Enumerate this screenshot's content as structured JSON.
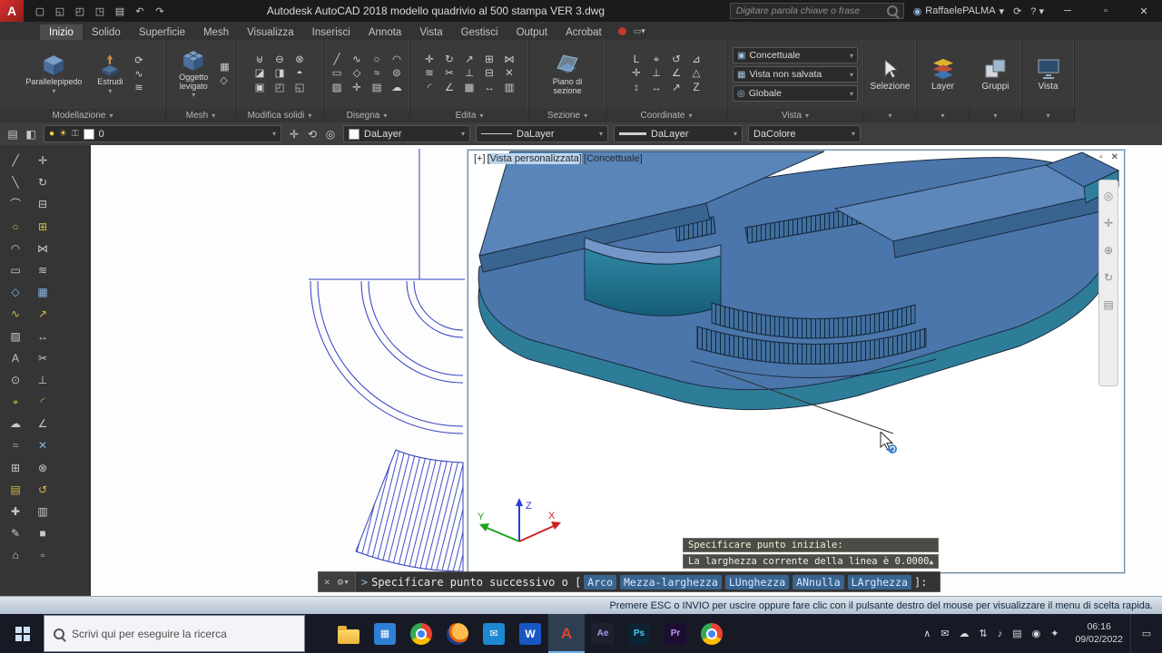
{
  "titlebar": {
    "logo": "A",
    "quick_access": [
      {
        "g": "▢",
        "name": "qnew-icon"
      },
      {
        "g": "◱",
        "name": "open-icon"
      },
      {
        "g": "◰",
        "name": "save-icon"
      },
      {
        "g": "◳",
        "name": "saveas-icon"
      },
      {
        "g": "▤",
        "name": "plot-icon"
      },
      {
        "g": "↶",
        "name": "undo-icon"
      },
      {
        "g": "↷",
        "name": "redo-icon"
      }
    ],
    "title": "Autodesk AutoCAD 2018   modello quadrivio al 500 stampa VER 3.dwg",
    "search_placeholder": "Digitare parola chiave o frase",
    "signin_user": "RaffaelePALMA",
    "help_label": "?"
  },
  "ribbon": {
    "tabs": [
      {
        "label": "Inizio",
        "name": "tab-inizio",
        "active": true
      },
      {
        "label": "Solido",
        "name": "tab-solido"
      },
      {
        "label": "Superficie",
        "name": "tab-superficie"
      },
      {
        "label": "Mesh",
        "name": "tab-mesh"
      },
      {
        "label": "Visualizza",
        "name": "tab-visualizza"
      },
      {
        "label": "Inserisci",
        "name": "tab-inserisci"
      },
      {
        "label": "Annota",
        "name": "tab-annota"
      },
      {
        "label": "Vista",
        "name": "tab-vista"
      },
      {
        "label": "Gestisci",
        "name": "tab-gestisci"
      },
      {
        "label": "Output",
        "name": "tab-output"
      },
      {
        "label": "Acrobat",
        "name": "tab-acrobat"
      }
    ],
    "panels": {
      "modellazione": {
        "label": "Modellazione",
        "btn_box": "Parallelepipedo",
        "btn_extrude": "Estrudi",
        "icons": [
          {
            "g": "⟳",
            "name": "revolve-icon"
          },
          {
            "g": "∿",
            "name": "sweep-icon"
          },
          {
            "g": "≋",
            "name": "loft-icon"
          }
        ]
      },
      "mesh": {
        "label": "Mesh",
        "btn_smooth": "Oggetto levigato",
        "icons": [
          {
            "g": "▦",
            "name": "mesh-refine-icon"
          },
          {
            "g": "◇",
            "name": "mesh-edit-icon"
          }
        ]
      },
      "modifica_solidi": {
        "label": "Modifica solidi",
        "icons": [
          {
            "g": "⊎",
            "name": "union-icon"
          },
          {
            "g": "⊖",
            "name": "subtract-icon"
          },
          {
            "g": "⊗",
            "name": "intersect-icon"
          },
          {
            "g": "◪",
            "name": "slice-icon"
          },
          {
            "g": "◨",
            "name": "thicken-icon"
          },
          {
            "g": "◓",
            "name": "shell-icon"
          },
          {
            "g": "▣",
            "name": "imprint-icon"
          },
          {
            "g": "◰",
            "name": "extract-edges-icon"
          },
          {
            "g": "◱",
            "name": "interference-icon"
          }
        ]
      },
      "disegna": {
        "label": "Disegna",
        "icons": [
          {
            "g": "╱",
            "name": "line-icon"
          },
          {
            "g": "∿",
            "name": "polyline-icon"
          },
          {
            "g": "○",
            "name": "circle-icon"
          },
          {
            "g": "◠",
            "name": "arc-icon"
          },
          {
            "g": "▭",
            "name": "rectangle-icon"
          },
          {
            "g": "◇",
            "name": "polygon-icon"
          },
          {
            "g": "≈",
            "name": "spline-icon"
          },
          {
            "g": "⊜",
            "name": "ellipse-icon"
          },
          {
            "g": "▨",
            "name": "hatch-icon"
          },
          {
            "g": "✛",
            "name": "point-icon"
          },
          {
            "g": "▤",
            "name": "region-icon"
          },
          {
            "g": "☁",
            "name": "revision-cloud-icon"
          }
        ]
      },
      "edita": {
        "label": "Edita",
        "icons": [
          {
            "g": "✛",
            "name": "move-icon"
          },
          {
            "g": "↻",
            "name": "rotate-icon"
          },
          {
            "g": "↗",
            "name": "scale-icon"
          },
          {
            "g": "⊞",
            "name": "copy-icon"
          },
          {
            "g": "⋈",
            "name": "mirror-icon"
          },
          {
            "g": "≋",
            "name": "offset-icon"
          },
          {
            "g": "✂",
            "name": "trim-icon"
          },
          {
            "g": "⊥",
            "name": "extend-icon"
          },
          {
            "g": "⊟",
            "name": "erase-icon"
          },
          {
            "g": "✕",
            "name": "explode-icon"
          },
          {
            "g": "◜",
            "name": "fillet-icon"
          },
          {
            "g": "∠",
            "name": "chamfer-icon"
          },
          {
            "g": "▦",
            "name": "array-icon"
          },
          {
            "g": "↔",
            "name": "stretch-icon"
          },
          {
            "g": "▥",
            "name": "join-icon"
          }
        ]
      },
      "sezione": {
        "label": "Sezione",
        "btn_section": "Piano di sezione"
      },
      "coordinate": {
        "label": "Coordinate",
        "icons": [
          {
            "g": "L",
            "name": "ucs-icon"
          },
          {
            "g": "⌖",
            "name": "ucs-origin-icon"
          },
          {
            "g": "↺",
            "name": "ucs-previous-icon"
          },
          {
            "g": "⊿",
            "name": "ucs-3point-icon"
          },
          {
            "g": "✛",
            "name": "ucs-world-icon"
          },
          {
            "g": "⊥",
            "name": "ucs-zaxis-icon"
          },
          {
            "g": "∠",
            "name": "ucs-object-icon"
          },
          {
            "g": "△",
            "name": "ucs-face-icon"
          },
          {
            "g": "↕",
            "name": "ucs-y-icon"
          },
          {
            "g": "↔",
            "name": "ucs-x-icon"
          },
          {
            "g": "↗",
            "name": "ucs-z-icon"
          },
          {
            "g": "Z",
            "name": "ucs-named-icon"
          }
        ]
      },
      "vista": {
        "label": "Vista",
        "visual_style": "Concettuale",
        "view_name": "Vista non salvata",
        "ucs_name": "Globale"
      },
      "selezione": {
        "label": "Selezione"
      },
      "layer": {
        "label": "Layer"
      },
      "gruppi": {
        "label": "Gruppi"
      },
      "vista_dx": {
        "label": "Vista"
      }
    }
  },
  "propsbar": {
    "left_icons": [
      {
        "g": "▤",
        "name": "layer-properties-icon"
      },
      {
        "g": "◧",
        "name": "layer-states-icon"
      }
    ],
    "layer_value": "0",
    "mid_icons": [
      {
        "g": "✛",
        "name": "make-object-layer-current-icon"
      },
      {
        "g": "⟲",
        "name": "layer-previous-icon"
      },
      {
        "g": "◎",
        "name": "isolate-layer-icon"
      }
    ],
    "color_value": "DaLayer",
    "linetype_value": "DaLayer",
    "lineweight_value": "DaLayer",
    "plotstyle_value": "DaColore"
  },
  "palette": {
    "col1": [
      {
        "g": "╱",
        "name": "line-tool-icon"
      },
      {
        "g": "╲",
        "name": "construction-line-tool-icon"
      },
      {
        "g": "⌒",
        "name": "arc-tool-icon"
      },
      {
        "g": "○",
        "name": "circle-tool-icon"
      },
      {
        "g": "◠",
        "name": "spline-tool-icon"
      },
      {
        "g": "▭",
        "name": "rectangle-tool-icon"
      },
      {
        "g": "◇",
        "name": "polygon-tool-icon"
      },
      {
        "g": "∿",
        "name": "polyline-tool-icon"
      },
      {
        "g": "▨",
        "name": "hatch-tool-icon"
      },
      {
        "g": "A",
        "name": "text-tool-icon"
      },
      {
        "g": "⊙",
        "name": "donut-tool-icon"
      },
      {
        "g": "⌖",
        "name": "point-tool-icon"
      },
      {
        "g": "☁",
        "name": "revcloud-tool-icon"
      },
      {
        "g": "≈",
        "name": "mline-tool-icon"
      },
      {
        "g": "⊞",
        "name": "table-tool-icon"
      },
      {
        "g": "▤",
        "name": "region-tool-icon"
      },
      {
        "g": "✚",
        "name": "centerline-tool-icon"
      },
      {
        "g": "✎",
        "name": "sketch-tool-icon"
      },
      {
        "g": "⌂",
        "name": "block-tool-icon"
      }
    ],
    "col2": [
      {
        "g": "✛",
        "name": "move-tool-icon"
      },
      {
        "g": "↻",
        "name": "rotate-tool-icon"
      },
      {
        "g": "⊟",
        "name": "erase-tool-icon"
      },
      {
        "g": "⊞",
        "name": "copy-tool-icon"
      },
      {
        "g": "⋈",
        "name": "mirror-tool-icon"
      },
      {
        "g": "≋",
        "name": "offset-tool-icon"
      },
      {
        "g": "▦",
        "name": "array-tool-icon"
      },
      {
        "g": "↗",
        "name": "scale-tool-icon"
      },
      {
        "g": "↔",
        "name": "stretch-tool-icon"
      },
      {
        "g": "✂",
        "name": "trim-tool-icon"
      },
      {
        "g": "⊥",
        "name": "extend-tool-icon"
      },
      {
        "g": "◜",
        "name": "fillet-tool-icon"
      },
      {
        "g": "∠",
        "name": "chamfer-tool-icon"
      },
      {
        "g": "✕",
        "name": "explode-tool-icon"
      },
      {
        "g": "⊗",
        "name": "break-tool-icon"
      },
      {
        "g": "↺",
        "name": "undo-tool-icon"
      },
      {
        "g": "▥",
        "name": "join-tool-icon"
      },
      {
        "g": "■",
        "name": "solid-tool-icon"
      },
      {
        "g": "▫",
        "name": "properties-tool-icon"
      }
    ]
  },
  "viewport": {
    "label_plus": "[+]",
    "label_view": "[Vista personalizzata]",
    "label_style": "[Concettuale]",
    "nav_icons": [
      {
        "g": "◎",
        "name": "navigation-wheel-icon"
      },
      {
        "g": "✛",
        "name": "pan-icon"
      },
      {
        "g": "⊕",
        "name": "zoom-icon"
      },
      {
        "g": "↻",
        "name": "orbit-icon"
      },
      {
        "g": "▤",
        "name": "showmotion-icon"
      }
    ]
  },
  "ucs": {
    "x": "X",
    "y": "Y",
    "z": "Z"
  },
  "command": {
    "prompt_prefix": ">",
    "prompt": "Specificare punto successivo o [",
    "options": [
      "Arco",
      "Mezza-larghezza",
      "LUnghezza",
      "ANnulla",
      "LArghezza"
    ],
    "suffix": "]:",
    "tooltip_line1": "Specificare punto iniziale:",
    "tooltip_line2": "La larghezza corrente della linea è 0.0000"
  },
  "statusbar": {
    "message": "Premere ESC o INVIO per uscire oppure fare clic con il pulsante destro del mouse per visualizzare il menu di scelta rapida."
  },
  "taskbar": {
    "search_placeholder": "Scrivi qui per eseguire la ricerca",
    "apps": [
      {
        "name": "file-explorer-icon",
        "cls": "ic-folder"
      },
      {
        "name": "calculator-icon",
        "cls": "ic-calc",
        "g": "▦"
      },
      {
        "name": "chrome-icon",
        "cls": "ic-chrome"
      },
      {
        "name": "firefox-icon",
        "cls": "ic-firefox"
      },
      {
        "name": "mail-icon",
        "cls": "ic-mail",
        "g": "✉"
      },
      {
        "name": "word-icon",
        "cls": "ic-word",
        "g": "W"
      },
      {
        "name": "autocad-icon",
        "cls": "ic-acad",
        "g": "A",
        "active": true
      },
      {
        "name": "after-effects-icon",
        "cls": "ic-ae",
        "g": "Ae"
      },
      {
        "name": "photoshop-icon",
        "cls": "ic-ps",
        "g": "Ps"
      },
      {
        "name": "premiere-icon",
        "cls": "ic-pr",
        "g": "Pr"
      },
      {
        "name": "browser-icon",
        "cls": "ic-chrome"
      }
    ],
    "tray": [
      {
        "g": "∧",
        "name": "tray-expand-icon"
      },
      {
        "g": "✉",
        "name": "tray-mail-icon"
      },
      {
        "g": "☁",
        "name": "onedrive-icon"
      },
      {
        "g": "⇅",
        "name": "network-icon"
      },
      {
        "g": "♪",
        "name": "volume-icon"
      },
      {
        "g": "▤",
        "name": "task-view-icon"
      },
      {
        "g": "◉",
        "name": "antivirus-icon"
      },
      {
        "g": "✦",
        "name": "settings-tray-icon"
      }
    ],
    "time": "06:16",
    "date": "09/02/2022"
  }
}
